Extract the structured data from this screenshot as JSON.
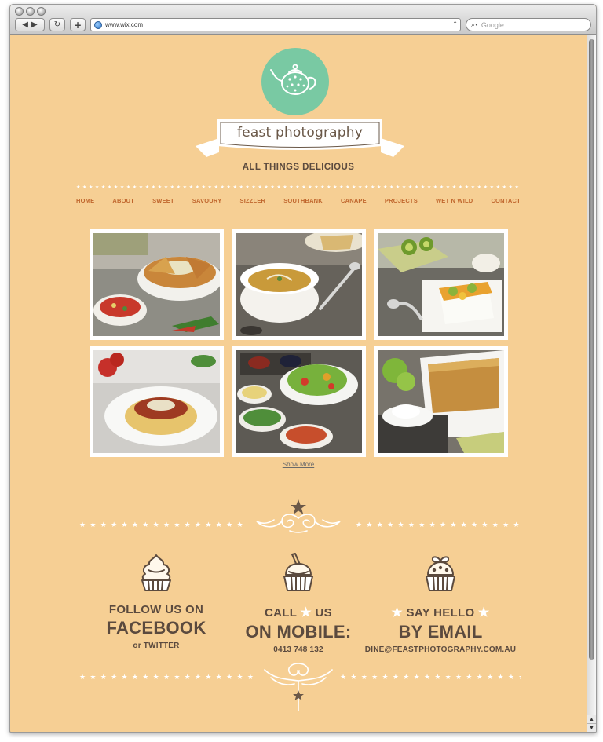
{
  "browser": {
    "url": "www.wix.com",
    "search_placeholder": "Google"
  },
  "site": {
    "title": "feast photography",
    "tagline": "ALL THINGS DELICIOUS",
    "logo_icon": "teapot-icon"
  },
  "nav": {
    "items": [
      "HOME",
      "ABOUT",
      "SWEET",
      "SAVOURY",
      "SIZZLER",
      "SOUTHBANK",
      "CANAPE",
      "PROJECTS",
      "WET N WILD",
      "CONTACT"
    ]
  },
  "gallery": {
    "photos": [
      "nachos-photo",
      "soup-photo",
      "kiwi-cake-photo",
      "spaghetti-photo",
      "salad-photo",
      "crumble-photo"
    ],
    "show_more": "Show More"
  },
  "contact": {
    "facebook": {
      "line1": "FOLLOW US ON",
      "line2": "FACEBOOK",
      "line3": "or TWITTER",
      "icon": "cupcake-swirl-icon"
    },
    "mobile": {
      "line1_a": "CALL",
      "line1_b": "US",
      "line2": "ON MOBILE:",
      "line3": "0413 748 132",
      "icon": "cupcake-straw-icon"
    },
    "email": {
      "line1": "SAY HELLO",
      "line2": "BY EMAIL",
      "line3": "DINE@FEASTPHOTOGRAPHY.COM.AU",
      "icon": "cupcake-bow-icon"
    }
  },
  "colors": {
    "background": "#f6cf94",
    "logo_circle": "#79c9a3",
    "nav_text": "#c0662d",
    "body_text": "#5b4a3e"
  }
}
